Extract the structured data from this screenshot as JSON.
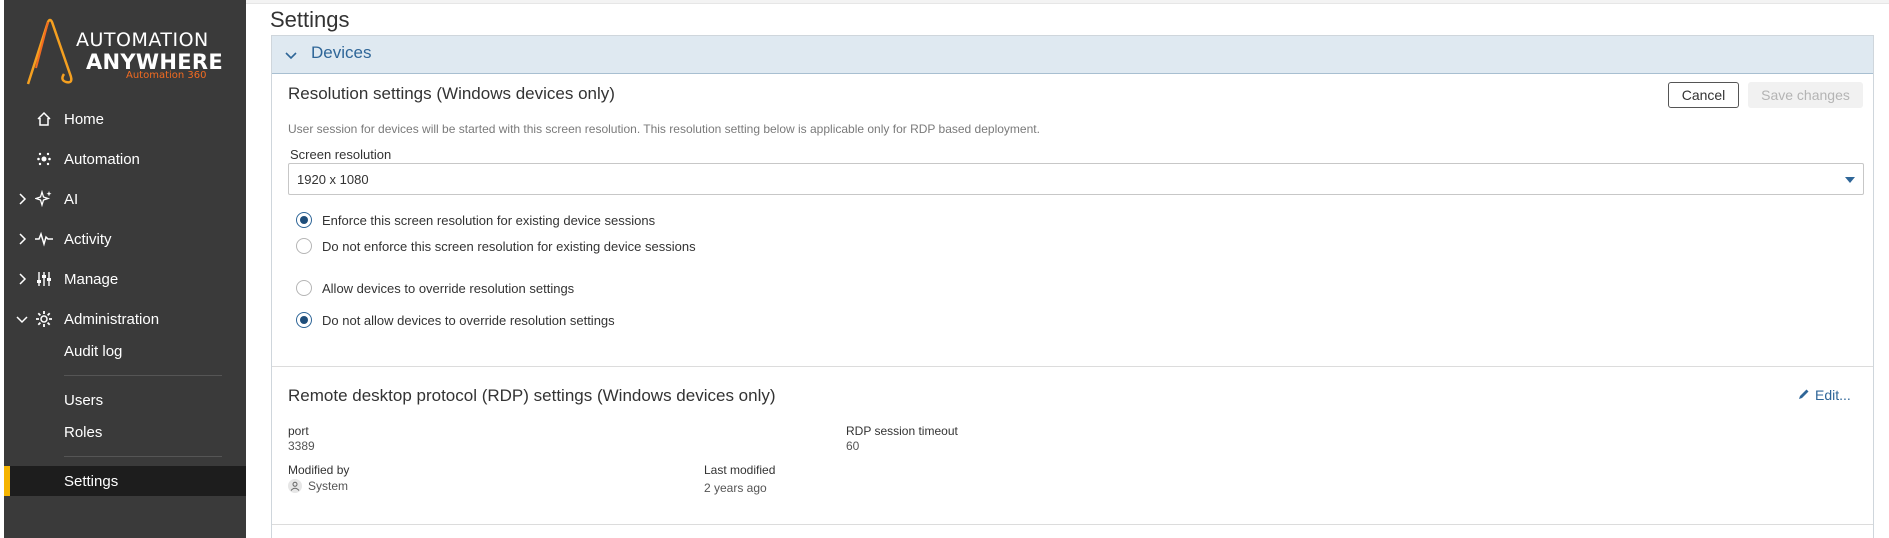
{
  "app": {
    "logo_line1": "AUTOMATION",
    "logo_line2": "ANYWHERE",
    "logo_sub": "Automation 360",
    "brand_color": "#f26b21"
  },
  "sidebar": {
    "items": [
      {
        "label": "Home",
        "icon": "home-icon"
      },
      {
        "label": "Automation",
        "icon": "automation-icon"
      },
      {
        "label": "AI",
        "icon": "ai-sparkle-icon",
        "expandable": true
      },
      {
        "label": "Activity",
        "icon": "activity-icon",
        "expandable": true
      },
      {
        "label": "Manage",
        "icon": "manage-sliders-icon",
        "expandable": true
      },
      {
        "label": "Administration",
        "icon": "gear-icon",
        "expanded": true
      }
    ],
    "subitems": [
      {
        "label": "Audit log"
      },
      {
        "label": "Users"
      },
      {
        "label": "Roles"
      },
      {
        "label": "Settings",
        "active": true
      }
    ],
    "active_accent": "#f5b400"
  },
  "page": {
    "title": "Settings"
  },
  "section": {
    "title": "Devices"
  },
  "resolution": {
    "title": "Resolution settings (Windows devices only)",
    "cancel_label": "Cancel",
    "save_label": "Save changes",
    "description": "User session for devices will be started with this screen resolution. This resolution setting below is applicable only for RDP based deployment.",
    "field_label": "Screen resolution",
    "selected_value": "1920 x 1080",
    "options": [
      {
        "label": "Enforce this screen resolution for existing device sessions",
        "checked": true
      },
      {
        "label": "Do not enforce this screen resolution for existing device sessions",
        "checked": false
      },
      {
        "label": "Allow devices to override resolution settings",
        "checked": false
      },
      {
        "label": "Do not allow devices to override resolution settings",
        "checked": true
      }
    ]
  },
  "rdp": {
    "title": "Remote desktop protocol (RDP) settings (Windows devices only)",
    "edit_label": "Edit...",
    "port_label": "port",
    "port_value": "3389",
    "timeout_label": "RDP session timeout",
    "timeout_value": "60",
    "modified_by_label": "Modified by",
    "modified_by_value": "System",
    "last_modified_label": "Last modified",
    "last_modified_value": "2 years ago"
  }
}
